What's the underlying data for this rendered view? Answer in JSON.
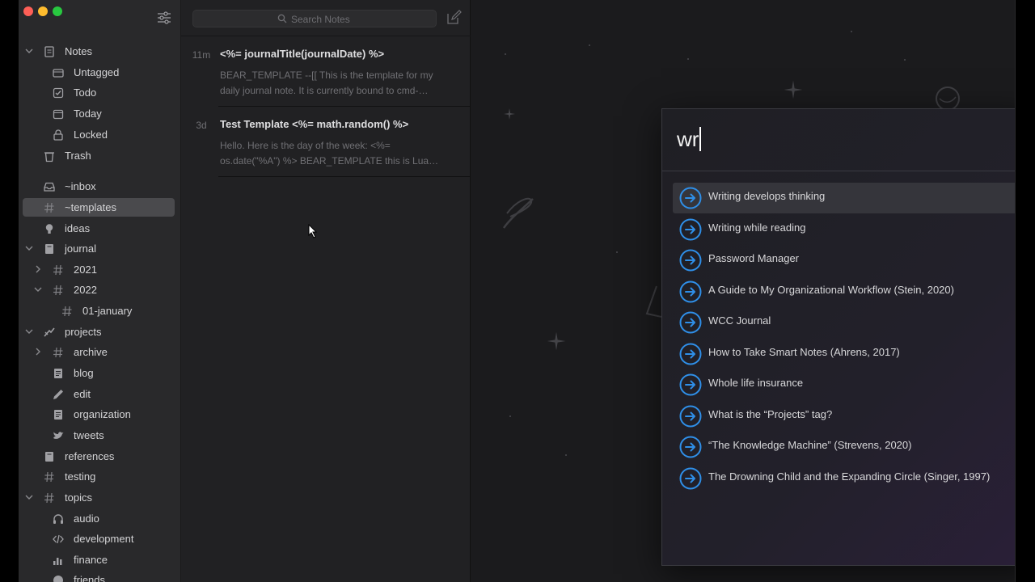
{
  "sidebar": {
    "items": [
      {
        "label": "Notes",
        "icon": "note-icon",
        "chevron": "down"
      },
      {
        "label": "Untagged",
        "icon": "untagged-icon"
      },
      {
        "label": "Todo",
        "icon": "todo-checkbox-icon"
      },
      {
        "label": "Today",
        "icon": "calendar-icon"
      },
      {
        "label": "Locked",
        "icon": "lock-icon"
      },
      {
        "label": "Trash",
        "icon": "trash-icon"
      },
      {
        "label": "~inbox",
        "icon": "inbox-icon"
      },
      {
        "label": "~templates",
        "icon": "hash-icon"
      },
      {
        "label": "ideas",
        "icon": "lightbulb-icon"
      },
      {
        "label": "journal",
        "icon": "book-icon",
        "chevron": "down"
      },
      {
        "label": "2021",
        "icon": "hash-icon",
        "chevron": "right"
      },
      {
        "label": "2022",
        "icon": "hash-icon",
        "chevron": "down"
      },
      {
        "label": "01-january",
        "icon": "hash-icon"
      },
      {
        "label": "projects",
        "icon": "projects-icon",
        "chevron": "down"
      },
      {
        "label": "archive",
        "icon": "hash-icon",
        "chevron": "right"
      },
      {
        "label": "blog",
        "icon": "document-icon"
      },
      {
        "label": "edit",
        "icon": "pencil-icon"
      },
      {
        "label": "organization",
        "icon": "document-icon"
      },
      {
        "label": "tweets",
        "icon": "bird-icon"
      },
      {
        "label": "references",
        "icon": "book-icon"
      },
      {
        "label": "testing",
        "icon": "hash-icon"
      },
      {
        "label": "topics",
        "icon": "hash-icon",
        "chevron": "down"
      },
      {
        "label": "audio",
        "icon": "headphones-icon"
      },
      {
        "label": "development",
        "icon": "code-icon"
      },
      {
        "label": "finance",
        "icon": "chart-icon"
      },
      {
        "label": "friends",
        "icon": "globe-icon"
      }
    ]
  },
  "notelist": {
    "search_placeholder": "Search Notes",
    "notes": [
      {
        "time": "11m",
        "title": "<%= journalTitle(journalDate) %>",
        "line1": "BEAR_TEMPLATE --[[ This is the template for my",
        "line2": "daily journal note. It is currently bound to cmd-…"
      },
      {
        "time": "3d",
        "title": "Test Template <%= math.random() %>",
        "line1": "Hello. Here is the day of the week: <%=",
        "line2": "os.date(\"%A\") %> BEAR_TEMPLATE this is Lua…"
      }
    ]
  },
  "popup": {
    "query": "wr",
    "results": [
      "Writing develops thinking",
      "Writing while reading",
      "Password Manager",
      "A Guide to My Organizational Workflow (Stein, 2020)",
      "WCC Journal",
      "How to Take Smart Notes (Ahrens, 2017)",
      "Whole life insurance",
      "What is the “Projects” tag?",
      "“The Knowledge Machine” (Strevens, 2020)",
      "The Drowning Child and the Expanding Circle (Singer, 1997)"
    ]
  },
  "colors": {
    "accent": "#2f8fe8",
    "traffic_red": "#fe5f57",
    "traffic_yellow": "#febc2e",
    "traffic_green": "#28c840"
  }
}
